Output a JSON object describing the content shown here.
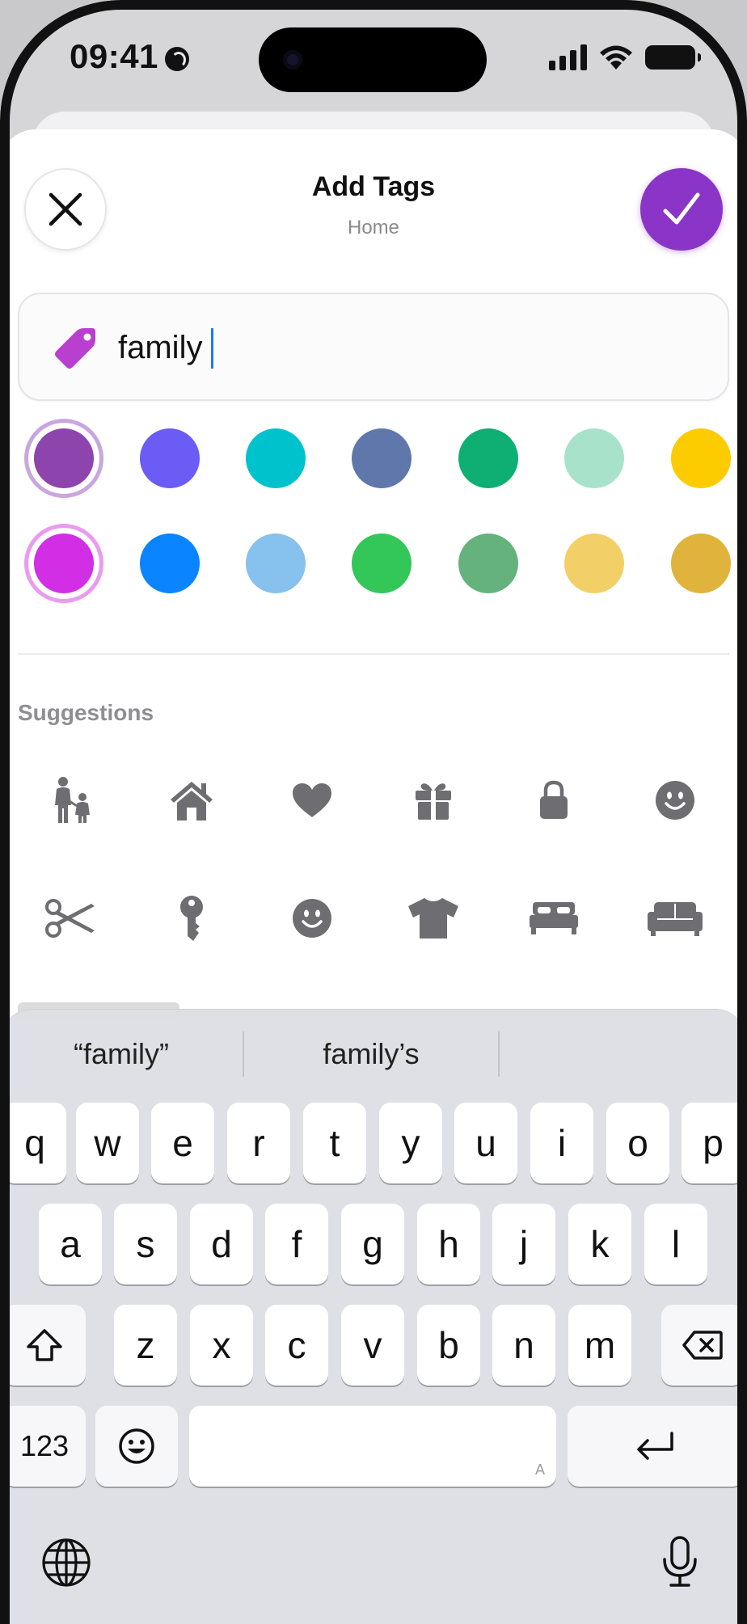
{
  "status_bar": {
    "time": "09:41",
    "location_icon": "globe-location-icon",
    "signal_icon": "cellular-signal-icon",
    "wifi_icon": "wifi-icon",
    "battery_icon": "battery-icon"
  },
  "header": {
    "title": "Add Tags",
    "subtitle": "Home",
    "close_icon": "close-icon",
    "done_icon": "checkmark-icon"
  },
  "tag_field": {
    "icon": "tag-icon",
    "value": "family",
    "icon_color": "#b93fcf"
  },
  "colors": {
    "accent": "#8a35c7",
    "selected_ring_row1": "#c9a6e0",
    "selected_ring_row2": "#ea9bf0",
    "row1": [
      "#8e44ad",
      "#6a5cf5",
      "#00c2cc",
      "#5f77ab",
      "#0fae73",
      "#a8e2ca",
      "#fdcc00"
    ],
    "row2": [
      "#d12ee6",
      "#0a84ff",
      "#87c1ed",
      "#33c659",
      "#65b27d",
      "#f2d067",
      "#e0b33c"
    ]
  },
  "suggestions": {
    "title": "Suggestions",
    "icons_row1": [
      "family-icon",
      "house-icon",
      "heart-icon",
      "gift-icon",
      "lock-icon",
      "smiley-icon"
    ],
    "icons_row2": [
      "scissors-icon",
      "key-icon",
      "smiley-icon",
      "tshirt-icon",
      "bed-icon",
      "sofa-icon"
    ]
  },
  "keyboard": {
    "predictions": [
      "“family”",
      "family’s",
      ""
    ],
    "row1": [
      "q",
      "w",
      "e",
      "r",
      "t",
      "y",
      "u",
      "i",
      "o",
      "p"
    ],
    "row2": [
      "a",
      "s",
      "d",
      "f",
      "g",
      "h",
      "j",
      "k",
      "l"
    ],
    "row3": [
      "z",
      "x",
      "c",
      "v",
      "b",
      "n",
      "m"
    ],
    "shift_icon": "shift-icon",
    "delete_icon": "delete-icon",
    "numbers_label": "123",
    "emoji_icon": "emoji-icon",
    "space_mark": "A",
    "return_icon": "return-icon",
    "globe_icon": "globe-icon",
    "mic_icon": "microphone-icon"
  }
}
